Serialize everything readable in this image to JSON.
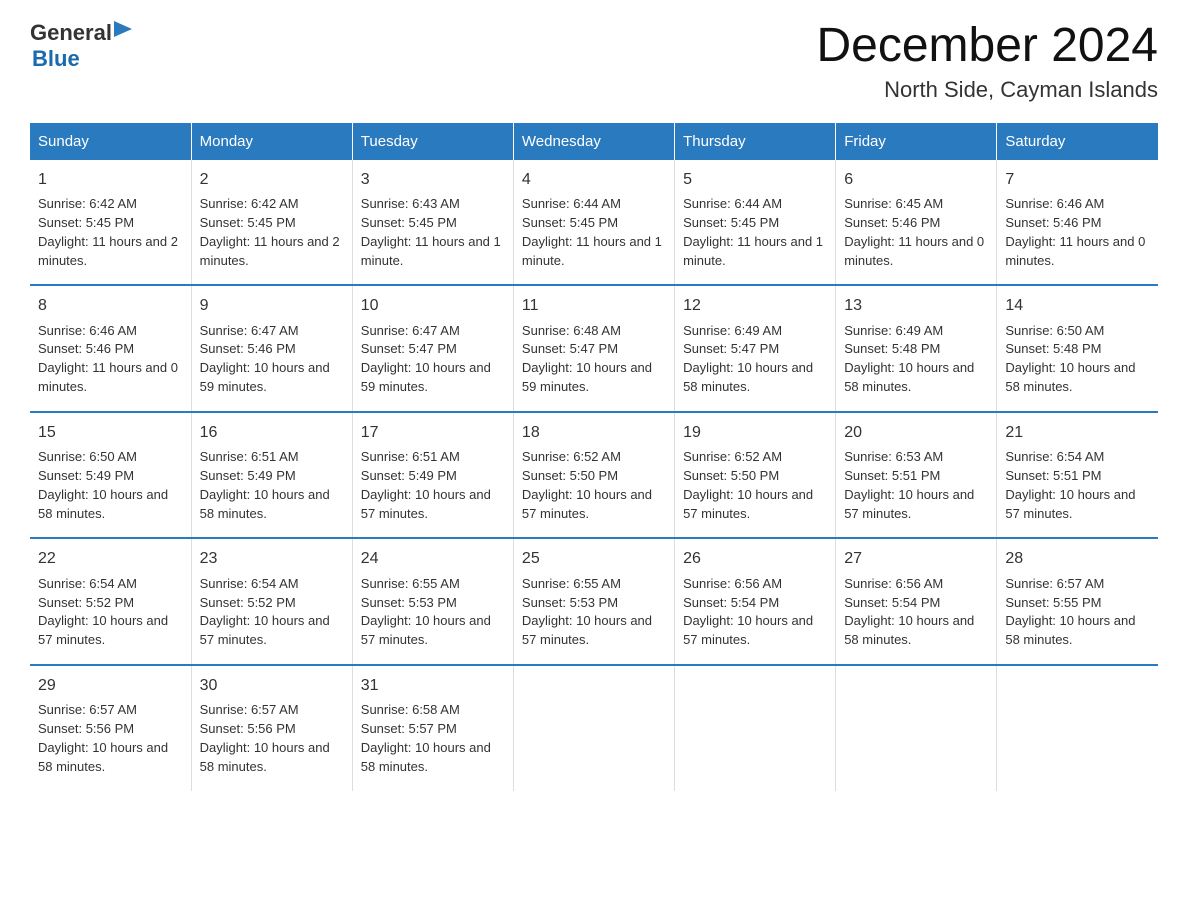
{
  "logo": {
    "general": "General",
    "blue": "Blue"
  },
  "title": {
    "month": "December 2024",
    "location": "North Side, Cayman Islands"
  },
  "headers": [
    "Sunday",
    "Monday",
    "Tuesday",
    "Wednesday",
    "Thursday",
    "Friday",
    "Saturday"
  ],
  "weeks": [
    [
      {
        "day": "1",
        "sunrise": "6:42 AM",
        "sunset": "5:45 PM",
        "daylight": "11 hours and 2 minutes."
      },
      {
        "day": "2",
        "sunrise": "6:42 AM",
        "sunset": "5:45 PM",
        "daylight": "11 hours and 2 minutes."
      },
      {
        "day": "3",
        "sunrise": "6:43 AM",
        "sunset": "5:45 PM",
        "daylight": "11 hours and 1 minute."
      },
      {
        "day": "4",
        "sunrise": "6:44 AM",
        "sunset": "5:45 PM",
        "daylight": "11 hours and 1 minute."
      },
      {
        "day": "5",
        "sunrise": "6:44 AM",
        "sunset": "5:45 PM",
        "daylight": "11 hours and 1 minute."
      },
      {
        "day": "6",
        "sunrise": "6:45 AM",
        "sunset": "5:46 PM",
        "daylight": "11 hours and 0 minutes."
      },
      {
        "day": "7",
        "sunrise": "6:46 AM",
        "sunset": "5:46 PM",
        "daylight": "11 hours and 0 minutes."
      }
    ],
    [
      {
        "day": "8",
        "sunrise": "6:46 AM",
        "sunset": "5:46 PM",
        "daylight": "11 hours and 0 minutes."
      },
      {
        "day": "9",
        "sunrise": "6:47 AM",
        "sunset": "5:46 PM",
        "daylight": "10 hours and 59 minutes."
      },
      {
        "day": "10",
        "sunrise": "6:47 AM",
        "sunset": "5:47 PM",
        "daylight": "10 hours and 59 minutes."
      },
      {
        "day": "11",
        "sunrise": "6:48 AM",
        "sunset": "5:47 PM",
        "daylight": "10 hours and 59 minutes."
      },
      {
        "day": "12",
        "sunrise": "6:49 AM",
        "sunset": "5:47 PM",
        "daylight": "10 hours and 58 minutes."
      },
      {
        "day": "13",
        "sunrise": "6:49 AM",
        "sunset": "5:48 PM",
        "daylight": "10 hours and 58 minutes."
      },
      {
        "day": "14",
        "sunrise": "6:50 AM",
        "sunset": "5:48 PM",
        "daylight": "10 hours and 58 minutes."
      }
    ],
    [
      {
        "day": "15",
        "sunrise": "6:50 AM",
        "sunset": "5:49 PM",
        "daylight": "10 hours and 58 minutes."
      },
      {
        "day": "16",
        "sunrise": "6:51 AM",
        "sunset": "5:49 PM",
        "daylight": "10 hours and 58 minutes."
      },
      {
        "day": "17",
        "sunrise": "6:51 AM",
        "sunset": "5:49 PM",
        "daylight": "10 hours and 57 minutes."
      },
      {
        "day": "18",
        "sunrise": "6:52 AM",
        "sunset": "5:50 PM",
        "daylight": "10 hours and 57 minutes."
      },
      {
        "day": "19",
        "sunrise": "6:52 AM",
        "sunset": "5:50 PM",
        "daylight": "10 hours and 57 minutes."
      },
      {
        "day": "20",
        "sunrise": "6:53 AM",
        "sunset": "5:51 PM",
        "daylight": "10 hours and 57 minutes."
      },
      {
        "day": "21",
        "sunrise": "6:54 AM",
        "sunset": "5:51 PM",
        "daylight": "10 hours and 57 minutes."
      }
    ],
    [
      {
        "day": "22",
        "sunrise": "6:54 AM",
        "sunset": "5:52 PM",
        "daylight": "10 hours and 57 minutes."
      },
      {
        "day": "23",
        "sunrise": "6:54 AM",
        "sunset": "5:52 PM",
        "daylight": "10 hours and 57 minutes."
      },
      {
        "day": "24",
        "sunrise": "6:55 AM",
        "sunset": "5:53 PM",
        "daylight": "10 hours and 57 minutes."
      },
      {
        "day": "25",
        "sunrise": "6:55 AM",
        "sunset": "5:53 PM",
        "daylight": "10 hours and 57 minutes."
      },
      {
        "day": "26",
        "sunrise": "6:56 AM",
        "sunset": "5:54 PM",
        "daylight": "10 hours and 57 minutes."
      },
      {
        "day": "27",
        "sunrise": "6:56 AM",
        "sunset": "5:54 PM",
        "daylight": "10 hours and 58 minutes."
      },
      {
        "day": "28",
        "sunrise": "6:57 AM",
        "sunset": "5:55 PM",
        "daylight": "10 hours and 58 minutes."
      }
    ],
    [
      {
        "day": "29",
        "sunrise": "6:57 AM",
        "sunset": "5:56 PM",
        "daylight": "10 hours and 58 minutes."
      },
      {
        "day": "30",
        "sunrise": "6:57 AM",
        "sunset": "5:56 PM",
        "daylight": "10 hours and 58 minutes."
      },
      {
        "day": "31",
        "sunrise": "6:58 AM",
        "sunset": "5:57 PM",
        "daylight": "10 hours and 58 minutes."
      },
      null,
      null,
      null,
      null
    ]
  ],
  "labels": {
    "sunrise": "Sunrise: ",
    "sunset": "Sunset: ",
    "daylight": "Daylight: "
  }
}
